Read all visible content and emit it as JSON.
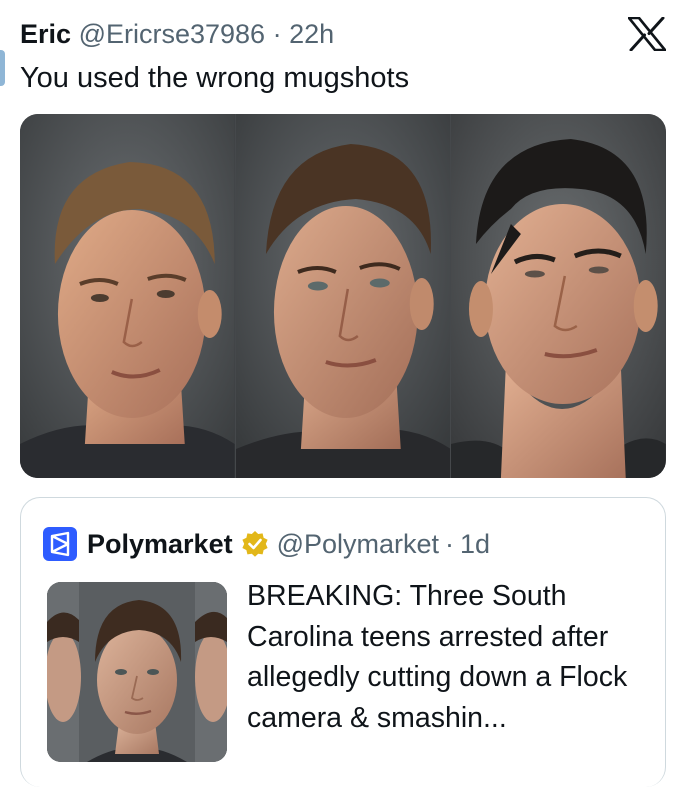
{
  "post": {
    "author_name": "Eric",
    "author_handle": "@Ericrse37986",
    "separator": "·",
    "timestamp": "22h",
    "text": "You used the wrong mugshots",
    "media_alt_subjects": [
      "mugshot-1",
      "mugshot-2",
      "mugshot-3"
    ]
  },
  "platform": {
    "logo_icon": "x-logo-icon"
  },
  "quoted_post": {
    "author_name": "Polymarket",
    "verified_badge_icon": "gold-verified-badge-icon",
    "author_handle": "@Polymarket",
    "separator": "·",
    "timestamp": "1d",
    "text": "BREAKING: Three South Carolina teens arrested after allegedly cutting down a Flock camera & smashin..."
  },
  "colors": {
    "text_primary": "#0f1419",
    "text_secondary": "#536471",
    "border": "#cfd9de",
    "polymarket_blue": "#2e5cff",
    "verified_gold": "#e2b719"
  }
}
